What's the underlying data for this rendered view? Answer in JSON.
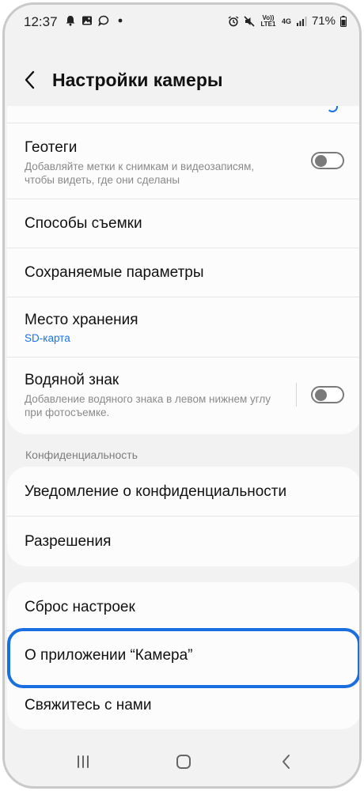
{
  "status_bar": {
    "time": "12:37",
    "volte_label": "Vo)) LTE1",
    "network_label": "4G",
    "battery": "71%",
    "left_icons": [
      "notification-bell-icon",
      "image-icon",
      "chat-bubble-icon",
      "dot-icon"
    ],
    "right_icons": [
      "alarm-icon",
      "mute-icon",
      "volte-icon",
      "signal-icon",
      "battery-icon"
    ]
  },
  "header": {
    "title": "Настройки камеры",
    "back_icon": "chevron-left-icon"
  },
  "settings_group_1": [
    {
      "label": "Геотеги",
      "description": "Добавляйте метки к снимкам и видеозаписям, чтобы видеть, где они сделаны",
      "toggle": "off"
    },
    {
      "label": "Способы съемки"
    },
    {
      "label": "Сохраняемые параметры"
    },
    {
      "label": "Место хранения",
      "value": "SD-карта"
    },
    {
      "label": "Водяной знак",
      "description": "Добавление водяного знака в левом нижнем углу при фотосъемке.",
      "toggle": "off"
    }
  ],
  "privacy_section": {
    "header": "Конфиденциальность",
    "items": [
      {
        "label": "Уведомление о конфиденциальности"
      },
      {
        "label": "Разрешения"
      }
    ]
  },
  "settings_group_3": [
    {
      "label": "Сброс настроек"
    },
    {
      "label": "О приложении “Камера”"
    },
    {
      "label": "Свяжитесь с нами"
    }
  ],
  "colors": {
    "accent": "#1a73e8",
    "highlight": "#1a6fe0",
    "background": "#f2f2f2",
    "card": "#fcfcfc"
  },
  "nav_bar": {
    "icons": [
      "recent-apps-icon",
      "home-icon",
      "back-icon"
    ]
  }
}
